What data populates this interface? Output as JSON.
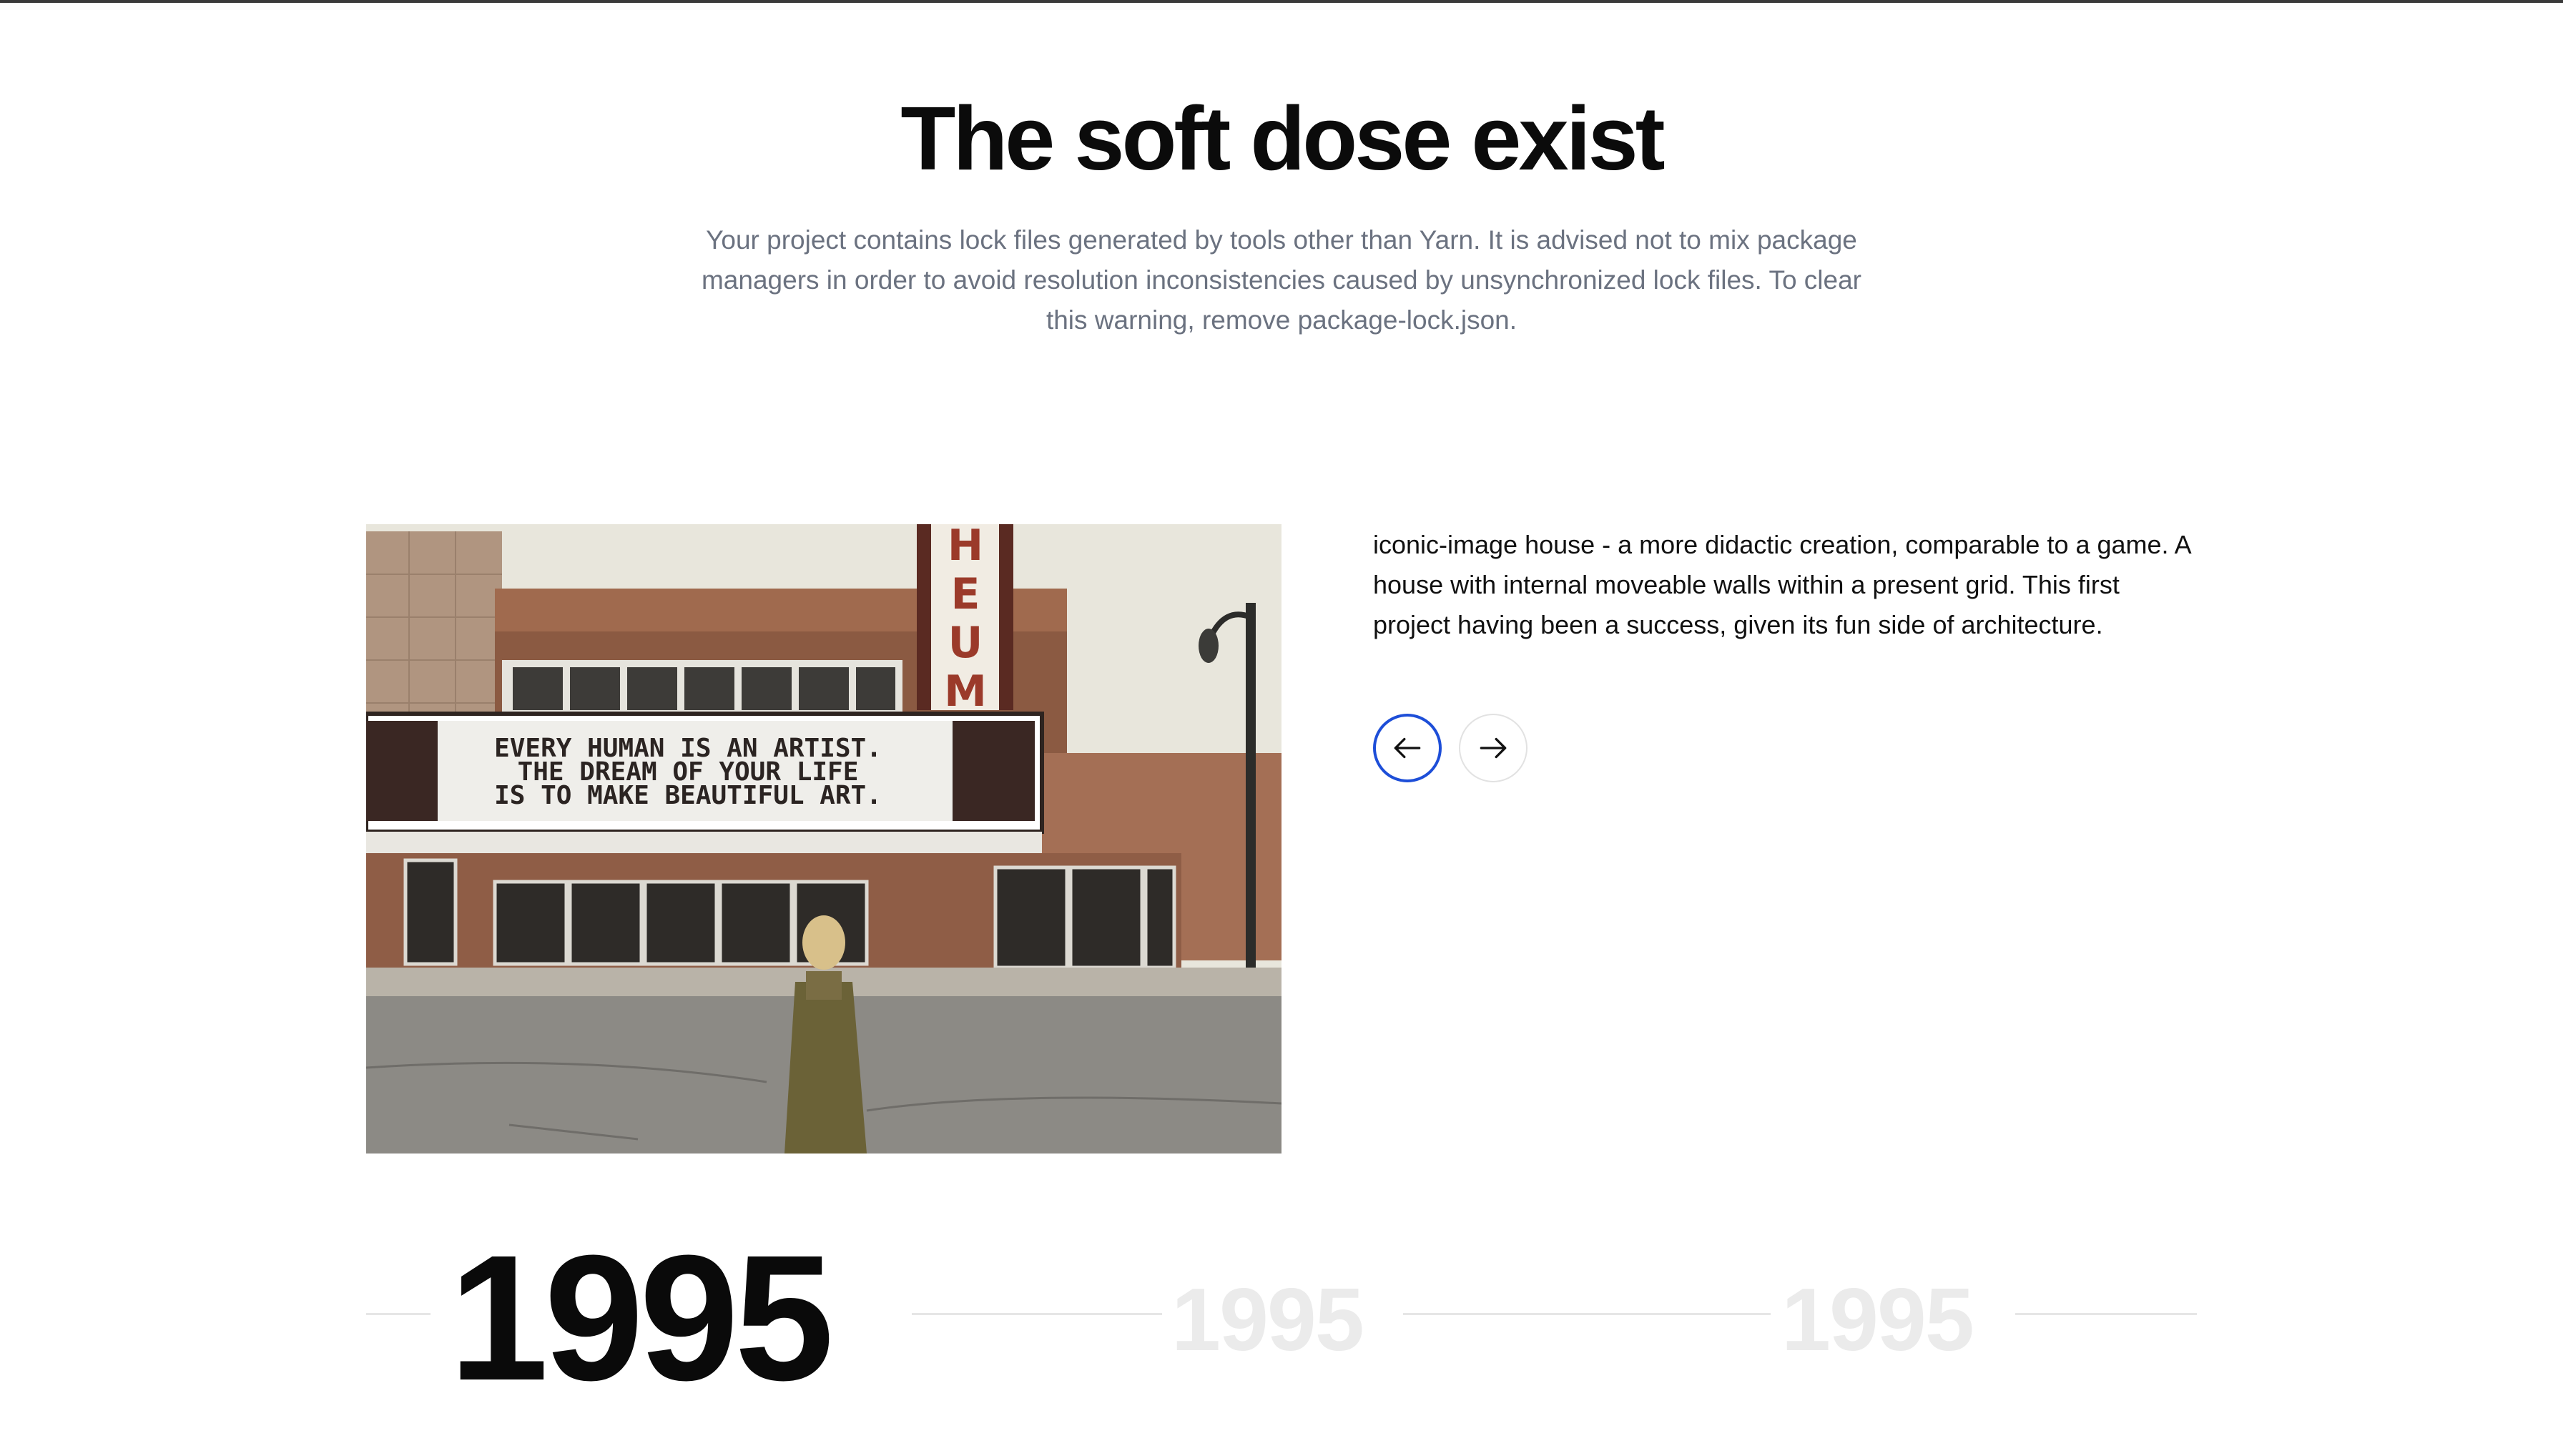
{
  "header": {
    "title": "The soft dose exist",
    "subtitle": "Your project contains lock files generated by tools other than Yarn. It is advised not to mix package managers in order to avoid resolution inconsistencies caused by unsynchronized lock files. To clear this warning, remove package-lock.json."
  },
  "slide": {
    "description": "iconic-image house - a more didactic creation, comparable to a game. A house with internal moveable walls within a present grid. This first project having been a success, given its fun side of architecture.",
    "photo": {
      "marquee_lines": [
        "EVERY HUMAN IS AN ARTIST.",
        "THE DREAM OF YOUR LIFE",
        "IS TO MAKE BEAUTIFUL ART."
      ],
      "sign_letters": [
        "H",
        "E",
        "U",
        "M"
      ]
    },
    "nav": {
      "prev_icon": "arrow-left-icon",
      "next_icon": "arrow-right-icon",
      "accent_color": "#1d4ed8"
    }
  },
  "timeline": {
    "active_year": "1995",
    "years": [
      "1995",
      "1995"
    ]
  }
}
